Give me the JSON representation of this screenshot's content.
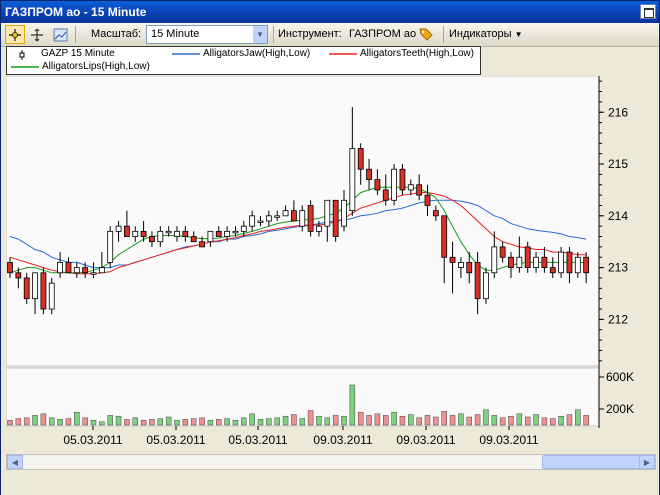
{
  "window": {
    "title": "ГАЗПРОМ ао - 15 Minute"
  },
  "toolbar": {
    "scale_label": "Масштаб:",
    "scale_value": "15 Minute",
    "instrument_label": "Инструмент:",
    "instrument_value": "ГАЗПРОМ ао",
    "indicators_label": "Индикаторы",
    "indicators_arrow": "▼"
  },
  "legend": {
    "items": [
      "GAZP 15 Minute",
      "AlligatorsJaw(High,Low)",
      "AlligatorsTeeth(High,Low)",
      "AlligatorsLips(High,Low)"
    ]
  },
  "colors": {
    "up": "#ffffff",
    "down": "#d9302a",
    "jaw": "#2a6ad8",
    "teeth": "#e82020",
    "lips": "#1a9a1a",
    "vol_up": "#7fd07f",
    "vol_down": "#f09090"
  },
  "chart_data": {
    "type": "candlestick",
    "price_ticks": [
      212,
      213,
      214,
      215,
      216
    ],
    "volume_ticks": [
      "200K",
      "600K"
    ],
    "x_labels": [
      "05.03.2011",
      "05.03.2011",
      "05.03.2011",
      "09.03.2011",
      "09.03.2011",
      "09.03.2011"
    ],
    "candles": [
      [
        213.1,
        213.2,
        212.8,
        212.9
      ],
      [
        212.9,
        213.0,
        212.6,
        212.8
      ],
      [
        212.8,
        212.9,
        212.3,
        212.4
      ],
      [
        212.4,
        212.9,
        212.1,
        212.9
      ],
      [
        212.9,
        213.0,
        212.1,
        212.2
      ],
      [
        212.2,
        212.8,
        212.1,
        212.7
      ],
      [
        212.9,
        213.3,
        212.8,
        213.1
      ],
      [
        213.1,
        213.2,
        212.9,
        212.9
      ],
      [
        212.9,
        213.1,
        212.8,
        213.0
      ],
      [
        213.0,
        213.1,
        212.8,
        212.9
      ],
      [
        212.9,
        213.1,
        212.8,
        212.9
      ],
      [
        212.9,
        213.3,
        212.9,
        213.0
      ],
      [
        213.1,
        213.8,
        213.0,
        213.7
      ],
      [
        213.7,
        213.9,
        213.5,
        213.8
      ],
      [
        213.8,
        214.1,
        213.6,
        213.6
      ],
      [
        213.6,
        213.8,
        213.5,
        213.7
      ],
      [
        213.7,
        213.9,
        213.5,
        213.6
      ],
      [
        213.6,
        213.7,
        213.4,
        213.5
      ],
      [
        213.5,
        213.8,
        213.4,
        213.7
      ],
      [
        213.7,
        213.8,
        213.6,
        213.7
      ],
      [
        213.6,
        213.8,
        213.5,
        213.7
      ],
      [
        213.7,
        213.8,
        213.5,
        213.6
      ],
      [
        213.6,
        213.7,
        213.5,
        213.5
      ],
      [
        213.5,
        213.6,
        213.4,
        213.4
      ],
      [
        213.5,
        213.7,
        213.4,
        213.7
      ],
      [
        213.7,
        213.8,
        213.6,
        213.6
      ],
      [
        213.6,
        213.8,
        213.5,
        213.7
      ],
      [
        213.7,
        213.8,
        213.6,
        213.7
      ],
      [
        213.7,
        213.9,
        213.6,
        213.8
      ],
      [
        213.8,
        214.1,
        213.7,
        214.0
      ],
      [
        213.9,
        214.0,
        213.8,
        213.9
      ],
      [
        213.9,
        214.1,
        213.8,
        214.0
      ],
      [
        214.0,
        214.1,
        213.9,
        214.0
      ],
      [
        214.0,
        214.2,
        214.0,
        214.1
      ],
      [
        214.1,
        214.3,
        213.9,
        213.9
      ],
      [
        213.8,
        214.2,
        213.7,
        214.1
      ],
      [
        214.2,
        214.3,
        213.6,
        213.7
      ],
      [
        213.7,
        213.9,
        213.6,
        213.8
      ],
      [
        213.8,
        214.3,
        213.5,
        214.3
      ],
      [
        214.3,
        214.3,
        213.5,
        213.6
      ],
      [
        213.8,
        214.5,
        213.7,
        214.3
      ],
      [
        214.1,
        216.1,
        214.0,
        215.3
      ],
      [
        215.3,
        215.4,
        214.6,
        214.9
      ],
      [
        214.9,
        215.1,
        214.5,
        214.7
      ],
      [
        214.7,
        214.9,
        214.4,
        214.5
      ],
      [
        214.5,
        214.8,
        214.2,
        214.3
      ],
      [
        214.3,
        215.0,
        214.2,
        214.9
      ],
      [
        214.9,
        215.0,
        214.4,
        214.5
      ],
      [
        214.5,
        214.7,
        214.4,
        214.6
      ],
      [
        214.6,
        214.8,
        214.3,
        214.4
      ],
      [
        214.4,
        214.6,
        214.0,
        214.2
      ],
      [
        214.1,
        214.2,
        213.9,
        214.0
      ],
      [
        214.0,
        214.0,
        212.7,
        213.2
      ],
      [
        213.2,
        213.5,
        212.5,
        213.1
      ],
      [
        213.0,
        213.2,
        212.8,
        213.1
      ],
      [
        213.1,
        213.3,
        212.7,
        212.9
      ],
      [
        213.1,
        213.3,
        212.1,
        212.4
      ],
      [
        212.4,
        213.0,
        212.3,
        212.9
      ],
      [
        212.9,
        213.7,
        212.8,
        213.4
      ],
      [
        213.4,
        213.5,
        213.1,
        213.2
      ],
      [
        213.2,
        213.3,
        212.8,
        213.0
      ],
      [
        213.0,
        213.6,
        212.9,
        213.2
      ],
      [
        213.4,
        213.5,
        212.9,
        213.0
      ],
      [
        213.0,
        213.3,
        212.9,
        213.2
      ],
      [
        213.2,
        213.4,
        212.9,
        213.0
      ],
      [
        213.0,
        213.2,
        212.8,
        212.9
      ],
      [
        212.9,
        213.4,
        212.8,
        213.3
      ],
      [
        213.3,
        213.4,
        212.7,
        212.9
      ],
      [
        212.9,
        213.3,
        212.8,
        213.2
      ],
      [
        213.2,
        213.3,
        212.7,
        212.9
      ]
    ],
    "jaw": [
      213.6,
      213.55,
      213.45,
      213.35,
      213.3,
      213.2,
      213.15,
      213.1,
      213.1,
      213.05,
      213.0,
      213.0,
      213.0,
      213.05,
      213.05,
      213.1,
      213.15,
      213.2,
      213.25,
      213.3,
      213.35,
      213.4,
      213.42,
      213.45,
      213.5,
      213.5,
      213.55,
      213.55,
      213.6,
      213.62,
      213.65,
      213.7,
      213.72,
      213.75,
      213.78,
      213.8,
      213.82,
      213.85,
      213.88,
      213.9,
      213.92,
      213.95,
      214.0,
      214.02,
      214.05,
      214.1,
      214.12,
      214.15,
      214.2,
      214.25,
      214.28,
      214.3,
      214.3,
      214.3,
      214.28,
      214.25,
      214.2,
      214.1,
      214.0,
      213.95,
      213.85,
      213.8,
      213.75,
      213.72,
      213.7,
      213.68,
      213.65,
      213.6,
      213.58,
      213.55
    ],
    "teeth": [
      213.2,
      213.15,
      213.1,
      213.05,
      213.0,
      212.95,
      212.92,
      212.9,
      212.88,
      212.88,
      212.88,
      212.9,
      212.92,
      213.0,
      213.05,
      213.1,
      213.15,
      213.2,
      213.25,
      213.3,
      213.35,
      213.38,
      213.42,
      213.45,
      213.5,
      213.52,
      213.55,
      213.58,
      213.62,
      213.65,
      213.7,
      213.72,
      213.75,
      213.78,
      213.8,
      213.82,
      213.82,
      213.82,
      213.85,
      213.88,
      213.95,
      214.05,
      214.15,
      214.2,
      214.25,
      214.3,
      214.35,
      214.4,
      214.42,
      214.45,
      214.45,
      214.42,
      214.38,
      214.3,
      214.2,
      214.05,
      213.9,
      213.75,
      213.6,
      213.5,
      213.45,
      213.4,
      213.38,
      213.35,
      213.35,
      213.3,
      213.3,
      213.28,
      213.25,
      213.25
    ],
    "lips": [
      212.9,
      212.95,
      213.0,
      213.0,
      212.95,
      212.9,
      212.9,
      212.9,
      212.9,
      212.9,
      212.95,
      213.0,
      213.1,
      213.25,
      213.35,
      213.45,
      213.55,
      213.6,
      213.62,
      213.62,
      213.62,
      213.6,
      213.58,
      213.56,
      213.56,
      213.57,
      213.6,
      213.62,
      213.66,
      213.7,
      213.75,
      213.8,
      213.85,
      213.88,
      213.9,
      213.92,
      213.93,
      213.95,
      214.0,
      214.05,
      214.15,
      214.3,
      214.45,
      214.5,
      214.55,
      214.55,
      214.55,
      214.55,
      214.55,
      214.52,
      214.45,
      214.35,
      214.1,
      213.8,
      213.5,
      213.25,
      213.05,
      212.95,
      212.95,
      213.0,
      213.05,
      213.08,
      213.1,
      213.1,
      213.1,
      213.1,
      213.1,
      213.1,
      213.1,
      213.1
    ],
    "volume": [
      60,
      80,
      90,
      120,
      140,
      90,
      70,
      80,
      160,
      90,
      60,
      40,
      120,
      110,
      70,
      90,
      60,
      70,
      80,
      100,
      60,
      70,
      80,
      90,
      60,
      70,
      80,
      60,
      90,
      140,
      70,
      80,
      90,
      110,
      130,
      80,
      180,
      110,
      90,
      120,
      110,
      500,
      160,
      120,
      140,
      120,
      160,
      110,
      130,
      90,
      120,
      100,
      170,
      120,
      140,
      100,
      130,
      190,
      120,
      90,
      110,
      140,
      100,
      130,
      90,
      80,
      110,
      130,
      190,
      120
    ]
  }
}
